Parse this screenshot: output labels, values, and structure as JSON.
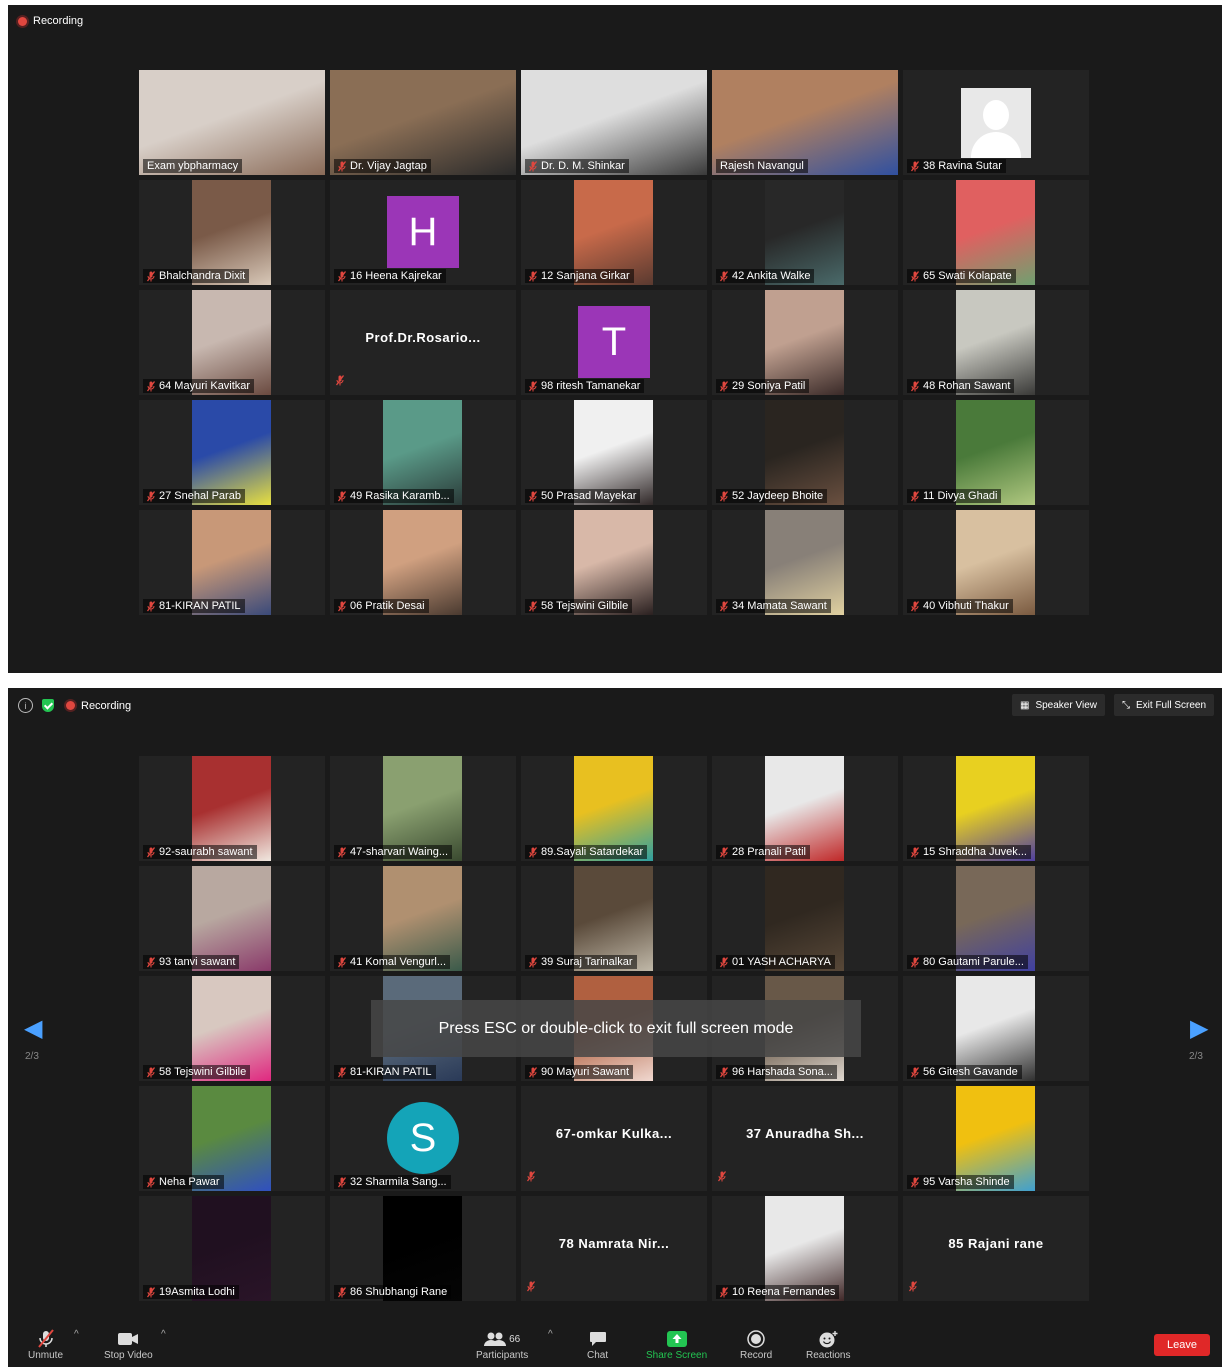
{
  "top_window": {
    "recording_label": "Recording",
    "tiles": [
      {
        "name": "Exam ybpharmacy",
        "kind": "video",
        "colors": [
          "#d8cfc8",
          "#8a6b58"
        ],
        "muted": false,
        "active": true,
        "wide": true
      },
      {
        "name": "Dr. Vijay Jagtap",
        "kind": "video",
        "colors": [
          "#8a6e55",
          "#2a2a2a"
        ],
        "muted": true,
        "wide": true
      },
      {
        "name": "Dr. D. M. Shinkar",
        "kind": "video",
        "colors": [
          "#dedede",
          "#3a3a3a"
        ],
        "muted": true,
        "wide": true
      },
      {
        "name": "Rajesh Navangul",
        "kind": "video",
        "colors": [
          "#b08060",
          "#3050a0"
        ],
        "muted": false,
        "wide": true
      },
      {
        "name": "38 Ravina Sutar",
        "kind": "silhouette",
        "muted": true
      },
      {
        "name": "Bhalchandra Dixit",
        "kind": "video",
        "colors": [
          "#7a5a48",
          "#d8c8b8"
        ],
        "muted": true
      },
      {
        "name": "16 Heena Kajrekar",
        "kind": "letter",
        "letter": "H",
        "color": "#9b36b7",
        "muted": true
      },
      {
        "name": "12 Sanjana Girkar",
        "kind": "video",
        "colors": [
          "#c86a4a",
          "#5a3a30"
        ],
        "muted": true
      },
      {
        "name": "42 Ankita Walke",
        "kind": "video",
        "colors": [
          "#282828",
          "#4a6a6a"
        ],
        "muted": true
      },
      {
        "name": "65 Swati Kolapate",
        "kind": "video",
        "colors": [
          "#e06060",
          "#70a070"
        ],
        "muted": true
      },
      {
        "name": "64 Mayuri Kavitkar",
        "kind": "video",
        "colors": [
          "#c8b8b0",
          "#6a4a40"
        ],
        "muted": true
      },
      {
        "name": "",
        "kind": "text",
        "display": "Prof.Dr.Rosario...",
        "muted": true
      },
      {
        "name": "98 ritesh Tamanekar",
        "kind": "letter",
        "letter": "T",
        "color": "#9b36b7",
        "muted": true
      },
      {
        "name": "29 Soniya Patil",
        "kind": "video",
        "colors": [
          "#c0a090",
          "#3a2a28"
        ],
        "muted": true
      },
      {
        "name": "48 Rohan Sawant",
        "kind": "video",
        "colors": [
          "#c8c8c0",
          "#3a3a38"
        ],
        "muted": true
      },
      {
        "name": "27 Snehal Parab",
        "kind": "video",
        "colors": [
          "#2a4aa8",
          "#e8e040"
        ],
        "muted": true
      },
      {
        "name": "49 Rasika Karamb...",
        "kind": "video",
        "colors": [
          "#5a9a88",
          "#2a3a38"
        ],
        "muted": true
      },
      {
        "name": "50 Prasad Mayekar",
        "kind": "video",
        "colors": [
          "#f0f0f0",
          "#302828"
        ],
        "muted": true
      },
      {
        "name": "52 Jaydeep Bhoite",
        "kind": "video",
        "colors": [
          "#2a2520",
          "#6a5040"
        ],
        "muted": true
      },
      {
        "name": "11 Divya Ghadi",
        "kind": "video",
        "colors": [
          "#4a7a3a",
          "#b0c880"
        ],
        "muted": true
      },
      {
        "name": "81-KIRAN PATIL",
        "kind": "video",
        "colors": [
          "#c89878",
          "#3a4a7a"
        ],
        "muted": true
      },
      {
        "name": "06 Pratik Desai",
        "kind": "video",
        "colors": [
          "#d0a080",
          "#4a3a30"
        ],
        "muted": true
      },
      {
        "name": "58 Tejswini Gilbile",
        "kind": "video",
        "colors": [
          "#d8b8a8",
          "#2a2020"
        ],
        "muted": true
      },
      {
        "name": "34 Mamata Sawant",
        "kind": "video",
        "colors": [
          "#888078",
          "#e0d0a0"
        ],
        "muted": true
      },
      {
        "name": "40 Vibhuti Thakur",
        "kind": "video",
        "colors": [
          "#d8c0a0",
          "#7a5a40"
        ],
        "muted": true
      }
    ]
  },
  "bottom_window": {
    "recording_label": "Recording",
    "speaker_view_label": "Speaker View",
    "exit_full_screen_label": "Exit Full Screen",
    "page_label_left": "2/3",
    "page_label_right": "2/3",
    "toast": "Press ESC or double-click to exit full screen mode",
    "tiles": [
      {
        "name": "92-saurabh sawant",
        "kind": "video",
        "colors": [
          "#a83030",
          "#f0e8e0"
        ],
        "muted": true
      },
      {
        "name": "47-sharvari Waing...",
        "kind": "video",
        "colors": [
          "#8aa070",
          "#3a4a30"
        ],
        "muted": true
      },
      {
        "name": "89.Sayali Satardekar",
        "kind": "video",
        "colors": [
          "#e8c020",
          "#30a0a0"
        ],
        "muted": true
      },
      {
        "name": "28 Pranali Patil",
        "kind": "video",
        "colors": [
          "#e8e8e8",
          "#c02828"
        ],
        "muted": true
      },
      {
        "name": "15 Shraddha Juvek...",
        "kind": "video",
        "colors": [
          "#e8d020",
          "#5040a0"
        ],
        "muted": true
      },
      {
        "name": "93 tanvi sawant",
        "kind": "video",
        "colors": [
          "#b8a8a0",
          "#8a3a6a"
        ],
        "muted": true
      },
      {
        "name": "41 Komal Vengurl...",
        "kind": "video",
        "colors": [
          "#b09070",
          "#3a5a4a"
        ],
        "muted": true
      },
      {
        "name": "39 Suraj Tarinalkar",
        "kind": "video",
        "colors": [
          "#5a4a3a",
          "#c0b8a8"
        ],
        "muted": true
      },
      {
        "name": "01 YASH ACHARYA",
        "kind": "video",
        "colors": [
          "#302820",
          "#584838"
        ],
        "muted": true
      },
      {
        "name": "80 Gautami Parule...",
        "kind": "video",
        "colors": [
          "#786858",
          "#4040a0"
        ],
        "muted": true
      },
      {
        "name": "58 Tejswini Gilbile",
        "kind": "video",
        "colors": [
          "#d8c8c0",
          "#e02880"
        ],
        "muted": true
      },
      {
        "name": "81-KIRAN PATIL",
        "kind": "video",
        "colors": [
          "#5a6a7a",
          "#2a3a58"
        ],
        "muted": true
      },
      {
        "name": "90 Mayuri Sawant",
        "kind": "video",
        "colors": [
          "#b06040",
          "#f0d8d0"
        ],
        "muted": true
      },
      {
        "name": "96 Harshada Sona...",
        "kind": "video",
        "colors": [
          "#685848",
          "#e0d8d0"
        ],
        "muted": true
      },
      {
        "name": "56 Gitesh Gavande",
        "kind": "video",
        "colors": [
          "#e8e8e8",
          "#303030"
        ],
        "muted": true
      },
      {
        "name": "Neha Pawar",
        "kind": "video",
        "colors": [
          "#5a8a40",
          "#3050c0"
        ],
        "muted": true
      },
      {
        "name": "32   Sharmila Sang...",
        "kind": "circle",
        "letter": "S",
        "color": "#14a4b8",
        "muted": true
      },
      {
        "name": "",
        "kind": "text",
        "display": "67-omkar  Kulka...",
        "muted": true
      },
      {
        "name": "",
        "kind": "text",
        "display": "37  Anuradha Sh...",
        "muted": true
      },
      {
        "name": "95 Varsha Shinde",
        "kind": "video",
        "colors": [
          "#f0c010",
          "#40a0d0"
        ],
        "muted": true
      },
      {
        "name": "19Asmita Lodhi",
        "kind": "video",
        "colors": [
          "#201020",
          "#2a1428"
        ],
        "muted": true
      },
      {
        "name": "86 Shubhangi Rane",
        "kind": "video",
        "colors": [
          "#000000",
          "#050505"
        ],
        "muted": true
      },
      {
        "name": "",
        "kind": "text",
        "display": "78 Namrata Nir...",
        "muted": true
      },
      {
        "name": "10 Reena Fernandes",
        "kind": "video",
        "colors": [
          "#e8e8e8",
          "#402828"
        ],
        "muted": true
      },
      {
        "name": "",
        "kind": "text",
        "display": "85 Rajani rane",
        "muted": true
      }
    ]
  },
  "toolbar": {
    "unmute": "Unmute",
    "stop_video": "Stop Video",
    "participants": "Participants",
    "participants_count": "66",
    "chat": "Chat",
    "share_screen": "Share Screen",
    "record": "Record",
    "reactions": "Reactions",
    "leave": "Leave"
  },
  "colors": {
    "background": "#1a1a1a",
    "active_speaker": "#d6e26a",
    "recording": "#e0473f",
    "share_screen": "#23c552",
    "leave": "#e02828",
    "arrow": "#4aa0ff"
  }
}
